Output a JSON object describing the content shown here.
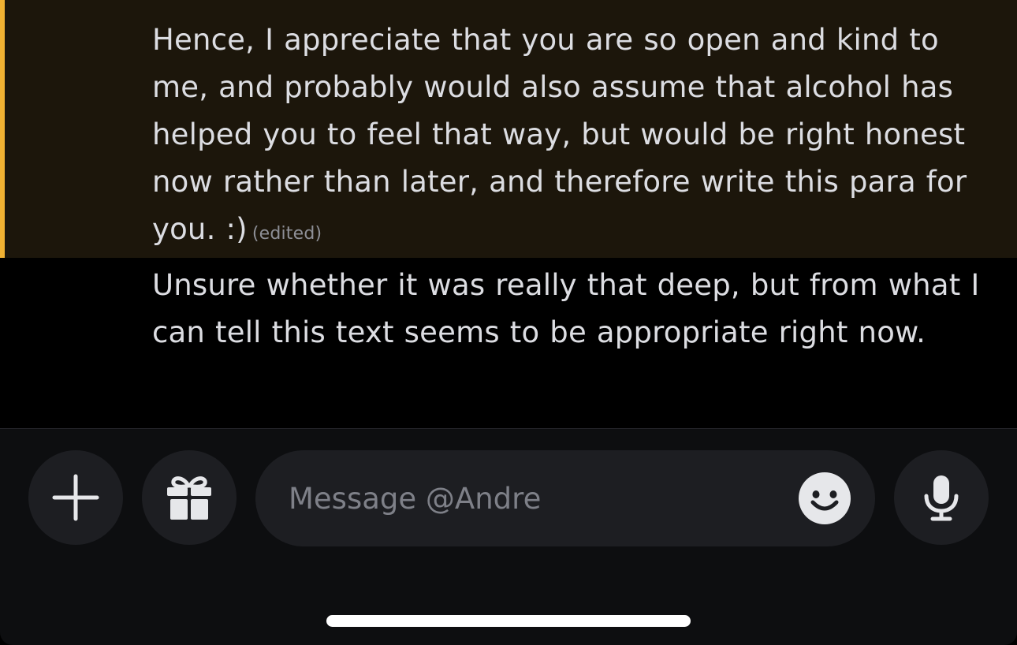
{
  "messages": [
    {
      "text": "Hence, I appreciate that you are so open and kind to me, and probably would also assume that alcohol has helped you to feel that way, but would be right honest now rather than later, and therefore write this para for you. :)",
      "edited_label": "(edited)",
      "highlighted": true
    },
    {
      "text": "Unsure whether it was really that deep, but from what I can tell this text seems to be appropriate right now."
    }
  ],
  "composer": {
    "placeholder": "Message @Andre",
    "value": "",
    "buttons": {
      "add": "plus-icon",
      "gift": "gift-icon",
      "emoji": "smile-icon",
      "voice": "microphone-icon"
    }
  },
  "colors": {
    "highlight_background": "#1c160b",
    "highlight_accent": "#f0b132",
    "message_text": "#dcdde2",
    "composer_background": "#0d0e10",
    "button_background": "#1d1e22"
  }
}
